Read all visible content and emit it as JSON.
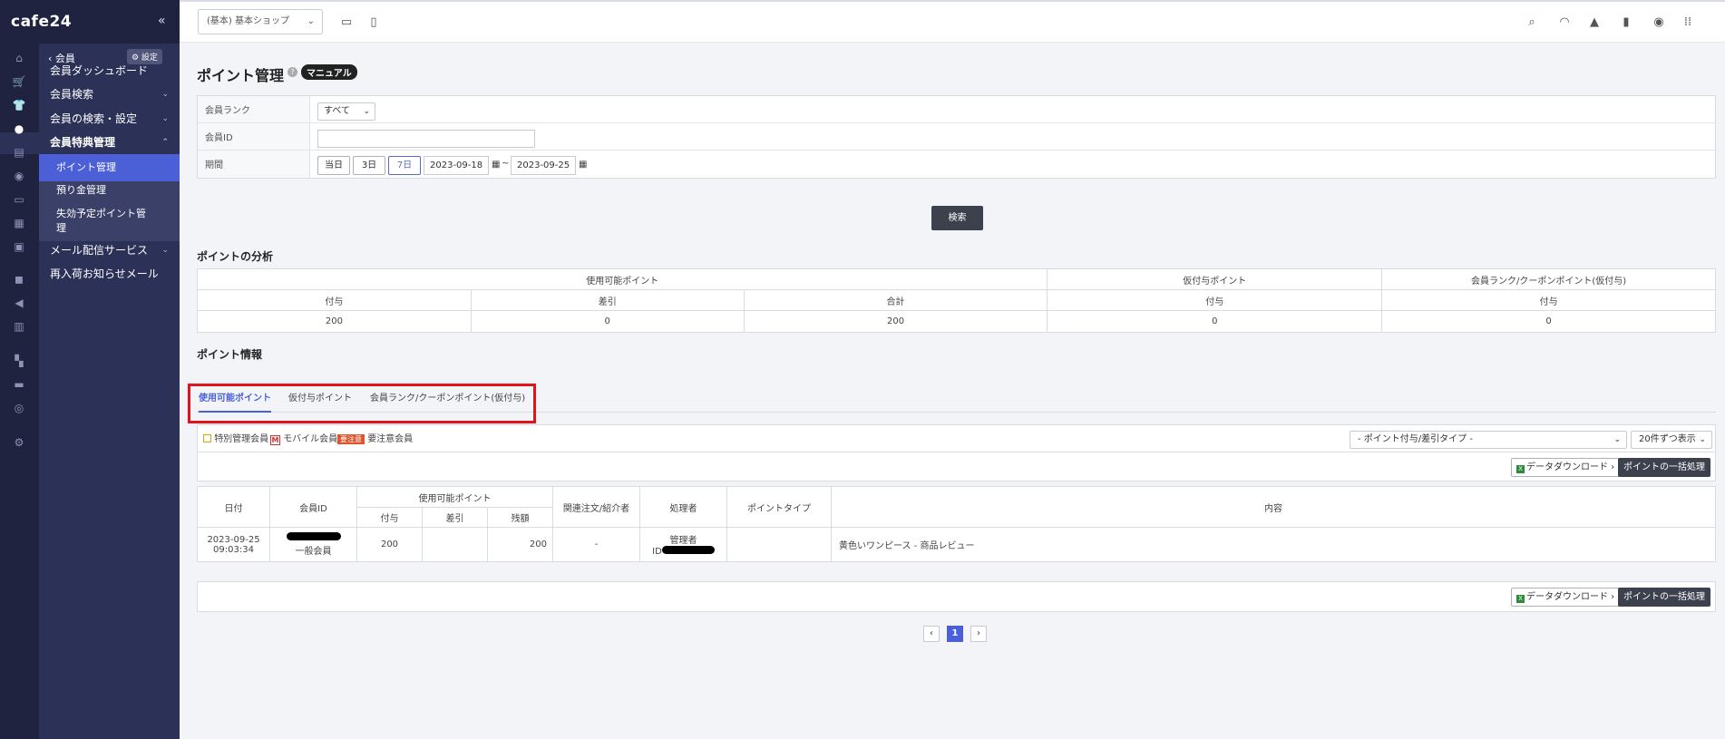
{
  "brand": {
    "logo": "cafe24",
    "collapse": "«"
  },
  "rail_icons": [
    "home-icon",
    "cart-icon",
    "shirt-icon",
    "user-icon",
    "document-icon",
    "palette-icon",
    "ticket-icon",
    "chart-icon",
    "book-icon",
    "bag-icon",
    "megaphone-icon",
    "store-icon",
    "apps-icon",
    "folder-icon",
    "copy-icon",
    "gear-icon"
  ],
  "sidebar": {
    "back_label": "‹ 会員",
    "setting_label": "⚙ 設定",
    "items": [
      {
        "label": "会員ダッシュボード",
        "chev": ""
      },
      {
        "label": "会員検索",
        "chev": "⌄"
      },
      {
        "label": "会員の検索・設定",
        "chev": "⌄"
      },
      {
        "label": "会員特典管理",
        "chev": "⌃"
      }
    ],
    "subitems": [
      "ポイント管理",
      "預り金管理",
      "失効予定ポイント管理"
    ],
    "subitem_3_line2": "理",
    "subitem_3_line1": "失効予定ポイント管",
    "items_after": [
      {
        "label": "メール配信サービス",
        "chev": "⌄"
      },
      {
        "label": "再入荷お知らせメール",
        "chev": ""
      }
    ]
  },
  "topbar": {
    "shop_select": "(基本) 基本ショップ",
    "caret": "⌄"
  },
  "page": {
    "title": "ポイント管理",
    "help": "?",
    "manual": "マニュアル"
  },
  "filters": {
    "rank_label": "会員ランク",
    "rank_value": "すべて",
    "id_label": "会員ID",
    "period_label": "期間",
    "period_buttons": [
      "当日",
      "3日",
      "7日"
    ],
    "date_from": "2023-09-18",
    "date_sep": "~",
    "date_to": "2023-09-25",
    "search_button": "検索"
  },
  "analysis": {
    "title": "ポイントの分析",
    "group_usable": "使用可能ポイント",
    "group_provisional": "仮付与ポイント",
    "group_rank_coupon": "会員ランク/クーポンポイント(仮付与)",
    "col_grant": "付与",
    "col_deduct": "差引",
    "col_total": "合計",
    "col_grant2": "付与",
    "col_grant3": "付与",
    "val_grant": "200",
    "val_deduct": "0",
    "val_total": "200",
    "val_provisional": "0",
    "val_rank_coupon": "0"
  },
  "info": {
    "title": "ポイント情報",
    "tabs": [
      "使用可能ポイント",
      "仮付与ポイント",
      "会員ランク/クーポンポイント(仮付与)"
    ],
    "legend_special": "特別管理会員",
    "legend_m": "M",
    "legend_mobile": "モバイル会員",
    "legend_caution_badge": "要注意",
    "legend_caution": "要注意会員",
    "type_filter": "- ポイント付与/差引タイプ -",
    "per_page": "20件ずつ表示",
    "download": "データダウンロード ›",
    "bulk": "ポイントの一括処理",
    "xl": "X"
  },
  "table": {
    "h_date": "日付",
    "h_member": "会員ID",
    "h_usable": "使用可能ポイント",
    "h_grant": "付与",
    "h_deduct": "差引",
    "h_balance": "残額",
    "h_order": "関連注文/紹介者",
    "h_handler": "処理者",
    "h_type": "ポイントタイプ",
    "h_content": "内容",
    "rows": [
      {
        "date": "2023-09-25",
        "time": "09:03:34",
        "rank": "一般会員",
        "grant": "200",
        "deduct": "",
        "balance": "200",
        "order": "-",
        "handler": "管理者",
        "handler_id": "ID",
        "type": "",
        "content": "黄色いワンピース - 商品レビュー"
      }
    ]
  },
  "pagination": {
    "prev": "‹",
    "current": "1",
    "next": "›"
  }
}
